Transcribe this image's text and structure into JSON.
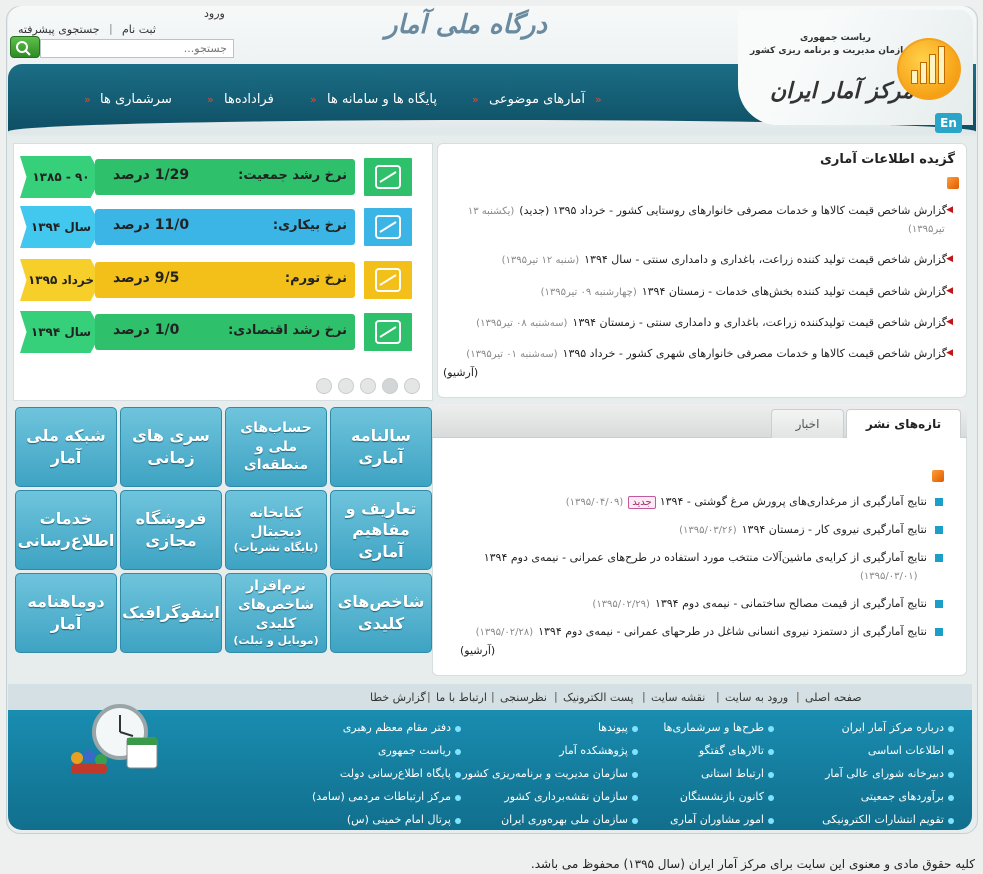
{
  "header": {
    "login": "ورود",
    "register": "ثبت نام",
    "advanced_search": "جستجوی پیشرفته",
    "search_placeholder": "جستجو...",
    "portal_title": "درگاه ملی آمار",
    "org_line1": "ریاست جمهوری",
    "org_line2": "سازمان مدیریت و برنامه ریزی کشور",
    "brand_name": "مرکز آمار ایران",
    "en_label": "En"
  },
  "nav": [
    {
      "label": "آمارهای موضوعی"
    },
    {
      "label": "پایگاه ها و سامانه ها"
    },
    {
      "label": "فراداده‌ها"
    },
    {
      "label": "سرشماری ها"
    }
  ],
  "stats": [
    {
      "label": "نرخ رشد جمعیت:",
      "value": "1/29 درصد",
      "period": "۹۰ - ۱۳۸۵",
      "color": "#2ec06a",
      "tag_color": "#36d07a",
      "icon": "population-icon"
    },
    {
      "label": "نرخ بیکاری:",
      "value": "11/0  درصد",
      "period": "سال ۱۳۹۴",
      "color": "#3ab5e6",
      "tag_color": "#42c7ee",
      "icon": "worker-icon"
    },
    {
      "label": "نرخ تورم:",
      "value": "9/5  درصد",
      "period": "خرداد ۱۳۹۵",
      "color": "#f2c019",
      "tag_color": "#f7cf2a",
      "icon": "inflation-chart-icon"
    },
    {
      "label": "نرخ رشد اقتصادی:",
      "value": "1/0  درصد",
      "period": "سال ۱۳۹۴",
      "color": "#2ec06a",
      "tag_color": "#36d07a",
      "icon": "growth-chart-icon"
    }
  ],
  "tiles": [
    [
      "سالنامه",
      "آماری"
    ],
    [
      "حساب‌های",
      "ملی و",
      "منطقه‌ای"
    ],
    [
      "سری های",
      "زمانی"
    ],
    [
      "شبکه ملی",
      "آمار"
    ],
    [
      "تعاریف و",
      "مفاهیم آماری"
    ],
    [
      "کتابخانه",
      "دیجیتال",
      "(پایگاه نشریات)"
    ],
    [
      "فروشگاه",
      "مجازی"
    ],
    [
      "خدمات",
      "اطلاع‌رسانی"
    ],
    [
      "شاخص‌های",
      "کلیدی"
    ],
    [
      "نرم‌افزار",
      "شاخص‌های کلیدی",
      "(موبایل و تبلت)"
    ],
    [
      "اینفوگرافیک"
    ],
    [
      "دوماهنامه",
      "آمار"
    ]
  ],
  "selected": {
    "title": "گزیده اطلاعات آماری",
    "items": [
      {
        "text": "گزارش شاخص قیمت کالاها و خدمات مصرفی خانوارهای روستایی کشور - خرداد ۱۳۹۵ (جدید)",
        "date": "(یکشنبه ۱۳",
        "date2": "تیر۱۳۹۵)"
      },
      {
        "text": "گزارش شاخص قیمت تولید کننده زراعت، باغداری و دامداری سنتی - سال ۱۳۹۴",
        "date": "(شنبه ۱۲ تیر۱۳۹۵)"
      },
      {
        "text": "گزارش شاخص قیمت تولید کننده بخش‌های خدمات - زمستان ۱۳۹۴",
        "date": "(چهارشنبه ۰۹ تیر۱۳۹۵)"
      },
      {
        "text": "گزارش شاخص قیمت تولیدکننده زراعت، باغداری و دامداری سنتی - زمستان ۱۳۹۴",
        "date": "(سه‌شنبه ۰۸ تیر۱۳۹۵)"
      },
      {
        "text": "گزارش شاخص قیمت کالاها و خدمات مصرفی خانوارهای شهری کشور - خرداد ۱۳۹۵",
        "date": "(سه‌شنبه ۰۱ تیر۱۳۹۵)"
      }
    ],
    "archive": "(آرشیو)"
  },
  "latest": {
    "tabs": [
      "تازه‌های نشر",
      "اخبار"
    ],
    "items": [
      {
        "text": "نتایج آمارگیری از مرغداری‌های پرورش مرغ گوشتی - ۱۳۹۴",
        "badge": "جدید",
        "date": "(۱۳۹۵/۰۴/۰۹)"
      },
      {
        "text": "نتایج آمارگیری نیروی کار - زمستان ۱۳۹۴",
        "date": "(۱۳۹۵/۰۳/۲۶)"
      },
      {
        "text": "نتایج آمارگیری از کرایه‌ی ماشین‌آلات منتخب مورد استفاده در طرح‌های عمرانی - نیمه‌ی دوم ۱۳۹۴",
        "date": "(۱۳۹۵/۰۳/۰۱)"
      },
      {
        "text": "نتایج آمارگیری از قیمت مصالح ساختمانی - نیمه‌ی دوم ۱۳۹۴",
        "date": "(۱۳۹۵/۰۲/۲۹)"
      },
      {
        "text": "نتایج آمارگیری از دستمزد نیروی انسانی شاغل در طرحهای عمرانی - نیمه‌ی دوم ۱۳۹۴",
        "date": "(۱۳۹۵/۰۲/۲۸)"
      }
    ],
    "archive": "(آرشیو)"
  },
  "footer": {
    "links": [
      "صفحه اصلی",
      "ورود به سایت",
      "نقشه سایت",
      "پست الکترونیک",
      "نظرسنجی",
      "ارتباط با ما",
      "گزارش خطا"
    ],
    "col1": [
      "درباره مرکز آمار ایران",
      "اطلاعات اساسی",
      "دبیرخانه شورای عالی آمار",
      "برآوردهای جمعیتی",
      "تقویم انتشارات الکترونیکی"
    ],
    "col2": [
      "طرح‌ها و سرشماری‌ها",
      "تالارهای گفتگو",
      "ارتباط استانی",
      "کانون بازنشستگان",
      "امور مشاوران آماری"
    ],
    "col3": [
      "پیوندها",
      "پژوهشکده آمار",
      "سازمان مدیریت و برنامه‌ریزی کشور",
      "سازمان نقشه‌برداری کشور",
      "سازمان ملی بهره‌وری ایران"
    ],
    "col4": [
      "دفتر مقام معظم رهبری",
      "ریاست جمهوری",
      "پایگاه اطلاع‌رسانی دولت",
      "مرکز ارتباطات مردمی (سامد)",
      "پرتال امام خمینی (س)"
    ]
  },
  "copyright": "کلیه حقوق مادی و معنوی این سایت برای مرکز آمار ایران (سال ۱۳۹۵) محفوظ می باشد."
}
